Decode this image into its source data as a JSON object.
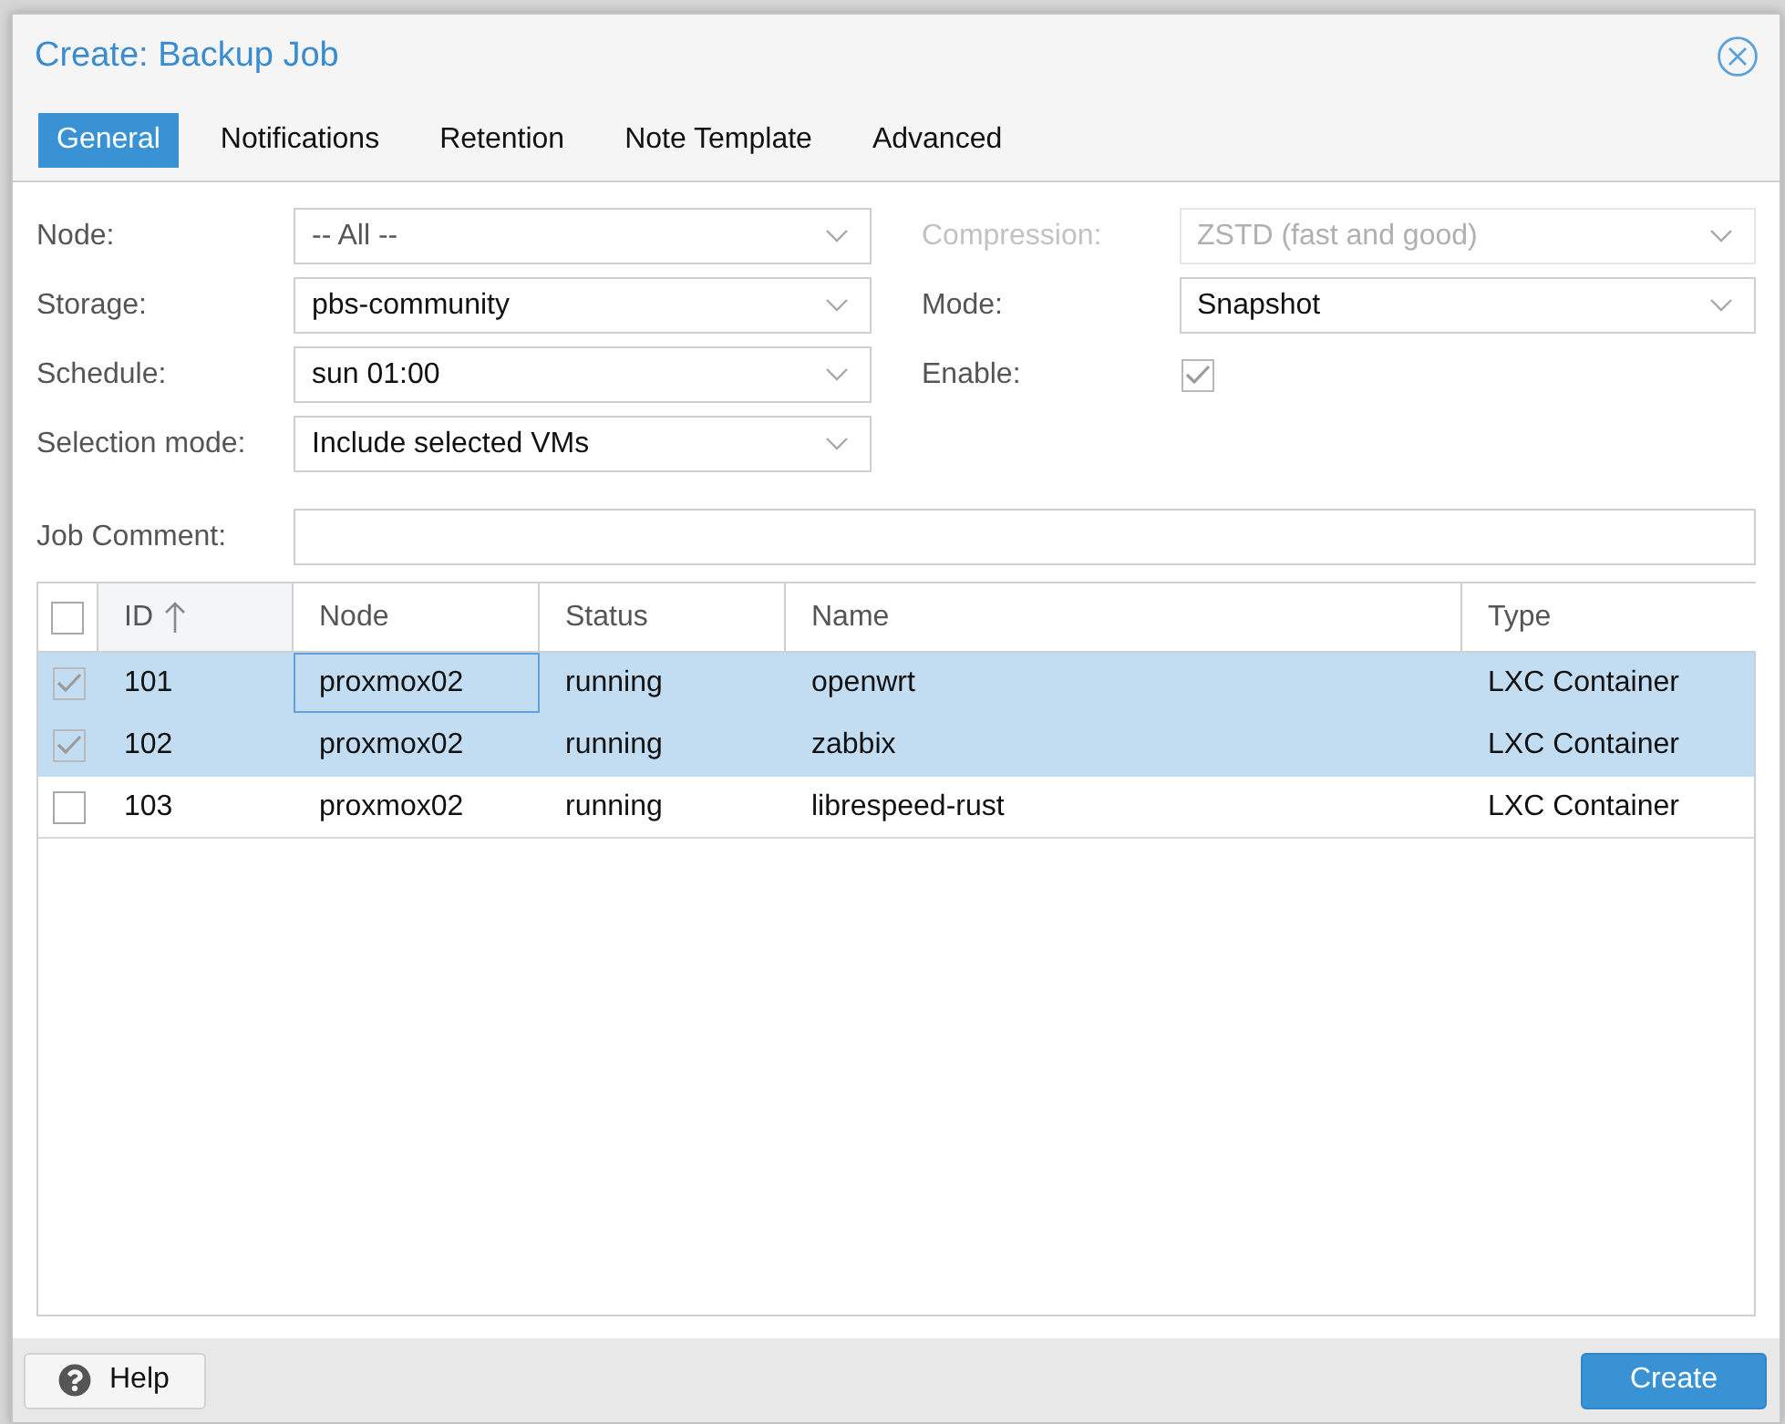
{
  "dialog": {
    "title": "Create: Backup Job"
  },
  "tabs": [
    {
      "label": "General",
      "selected": true
    },
    {
      "label": "Notifications",
      "selected": false
    },
    {
      "label": "Retention",
      "selected": false
    },
    {
      "label": "Note Template",
      "selected": false
    },
    {
      "label": "Advanced",
      "selected": false
    }
  ],
  "form": {
    "left": [
      {
        "kind": "dropdown",
        "label": "Node:",
        "placeholder": "-- All --",
        "disabled": false
      },
      {
        "kind": "dropdown",
        "label": "Storage:",
        "value": "pbs-community",
        "disabled": false
      },
      {
        "kind": "dropdown",
        "label": "Schedule:",
        "value": "sun 01:00",
        "disabled": false
      },
      {
        "kind": "dropdown",
        "label": "Selection mode:",
        "value": "Include selected VMs",
        "disabled": false
      }
    ],
    "right": [
      {
        "kind": "dropdown",
        "label": "Compression:",
        "value": "ZSTD (fast and good)",
        "disabled": true
      },
      {
        "kind": "dropdown",
        "label": "Mode:",
        "value": "Snapshot",
        "disabled": false
      },
      {
        "kind": "checkbox",
        "label": "Enable:",
        "checked": true,
        "disabled": false
      }
    ],
    "job_comment": {
      "label": "Job Comment:"
    }
  },
  "table": {
    "select_all": {
      "checked": false
    },
    "columns": [
      {
        "label": "ID",
        "sorted": true
      },
      {
        "label": "Node",
        "sorted": false
      },
      {
        "label": "Status",
        "sorted": false
      },
      {
        "label": "Name",
        "sorted": false
      },
      {
        "label": "Type",
        "sorted": false
      }
    ],
    "rows": [
      {
        "selected": true,
        "checked": true,
        "cells": [
          {
            "text": "101",
            "focused": false
          },
          {
            "text": "proxmox02",
            "focused": true
          },
          {
            "text": "running",
            "focused": false
          },
          {
            "text": "openwrt",
            "focused": false
          },
          {
            "text": "LXC Container",
            "focused": false
          }
        ]
      },
      {
        "selected": true,
        "checked": true,
        "cells": [
          {
            "text": "102",
            "focused": false
          },
          {
            "text": "proxmox02",
            "focused": false
          },
          {
            "text": "running",
            "focused": false
          },
          {
            "text": "zabbix",
            "focused": false
          },
          {
            "text": "LXC Container",
            "focused": false
          }
        ]
      },
      {
        "selected": false,
        "checked": false,
        "cells": [
          {
            "text": "103",
            "focused": false
          },
          {
            "text": "proxmox02",
            "focused": false
          },
          {
            "text": "running",
            "focused": false
          },
          {
            "text": "librespeed-rust",
            "focused": false
          },
          {
            "text": "LXC Container",
            "focused": false
          }
        ]
      }
    ]
  },
  "footer": {
    "buttons": [
      {
        "kind": "help",
        "label": "Help"
      },
      {
        "kind": "primary",
        "label": "Create"
      }
    ]
  }
}
